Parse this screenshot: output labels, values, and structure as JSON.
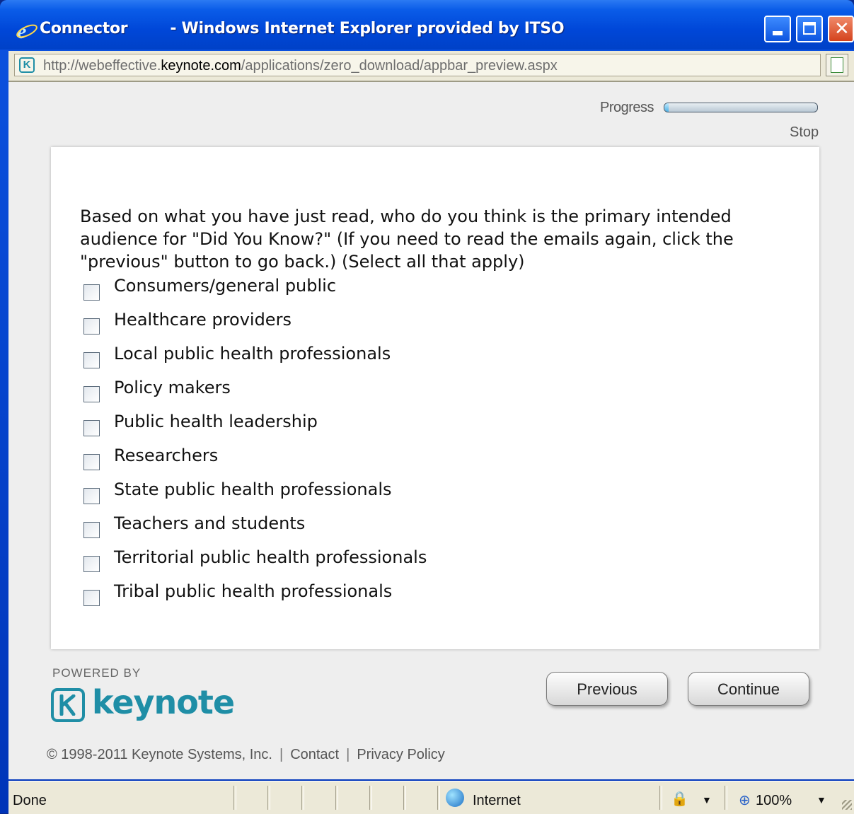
{
  "window": {
    "title_app": "Connector",
    "title_suffix": "- Windows Internet Explorer provided by ITSO",
    "controls": {
      "minimize": "minimize-icon",
      "maximize": "maximize-icon",
      "close": "close-icon"
    }
  },
  "address_bar": {
    "url_prefix": "http://webeffective.",
    "url_domain": "keynote.com",
    "url_path": "/applications/zero_download/appbar_preview.aspx"
  },
  "progress": {
    "label": "Progress",
    "value_fraction": 0.03
  },
  "stop_label": "Stop",
  "question": {
    "text": "Based on what you have just read, who do you think is the primary intended audience for \"Did You Know?\" (If you need to read the emails again, click the \"previous\" button to go back.) (Select all that apply)",
    "options": [
      {
        "label": "Consumers/general public",
        "checked": false
      },
      {
        "label": "Healthcare providers",
        "checked": false
      },
      {
        "label": "Local public health professionals",
        "checked": false
      },
      {
        "label": "Policy makers",
        "checked": false
      },
      {
        "label": "Public health leadership",
        "checked": false
      },
      {
        "label": "Researchers",
        "checked": false
      },
      {
        "label": "State public health professionals",
        "checked": false
      },
      {
        "label": "Teachers and students",
        "checked": false
      },
      {
        "label": "Territorial public health professionals",
        "checked": false
      },
      {
        "label": "Tribal public health professionals",
        "checked": false
      }
    ]
  },
  "branding": {
    "powered_by": "POWERED BY",
    "logo_text": "keynote"
  },
  "nav": {
    "previous": "Previous",
    "continue": "Continue"
  },
  "footer": {
    "copyright": "© 1998-2011 Keynote Systems, Inc.",
    "separator": "|",
    "contact": "Contact",
    "privacy": "Privacy Policy"
  },
  "status_bar": {
    "status": "Done",
    "zone": "Internet",
    "zoom": "100%"
  },
  "colors": {
    "brand": "#1f8ea6",
    "titlebar": "#0047d8"
  }
}
